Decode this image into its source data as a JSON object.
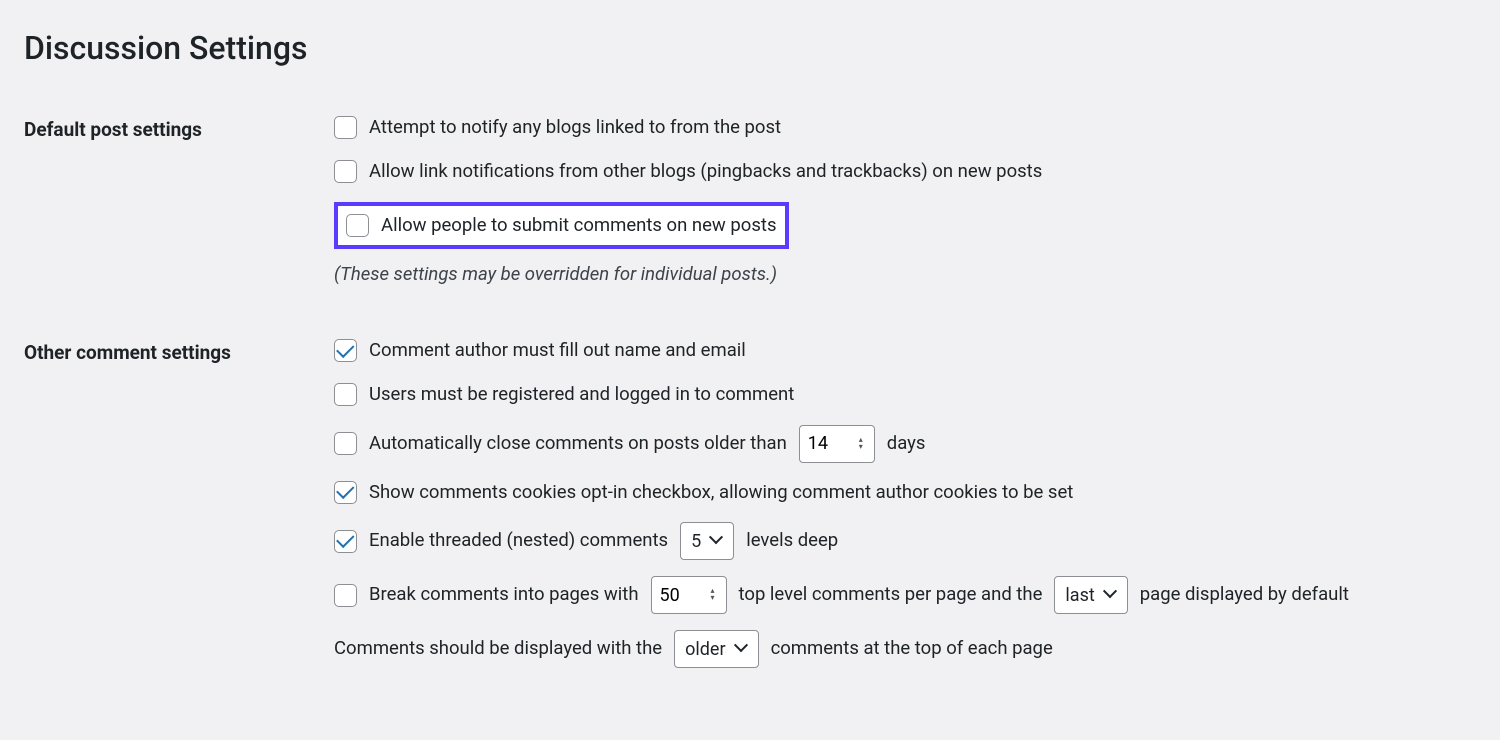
{
  "page_title": "Discussion Settings",
  "sections": {
    "default_post": {
      "heading": "Default post settings",
      "options": {
        "notify_blogs": {
          "label": "Attempt to notify any blogs linked to from the post",
          "checked": false
        },
        "allow_pingbacks": {
          "label": "Allow link notifications from other blogs (pingbacks and trackbacks) on new posts",
          "checked": false
        },
        "allow_comments": {
          "label": "Allow people to submit comments on new posts",
          "checked": false
        }
      },
      "note": "(These settings may be overridden for individual posts.)"
    },
    "other_comment": {
      "heading": "Other comment settings",
      "options": {
        "require_name_email": {
          "label": "Comment author must fill out name and email",
          "checked": true
        },
        "require_registered": {
          "label": "Users must be registered and logged in to comment",
          "checked": false
        },
        "auto_close": {
          "label_pre": "Automatically close comments on posts older than",
          "value": "14",
          "label_post": "days",
          "checked": false
        },
        "cookies_optin": {
          "label": "Show comments cookies opt-in checkbox, allowing comment author cookies to be set",
          "checked": true
        },
        "threaded": {
          "label_pre": "Enable threaded (nested) comments",
          "value": "5",
          "label_post": "levels deep",
          "checked": true
        },
        "paginate": {
          "label_pre": "Break comments into pages with",
          "per_page": "50",
          "label_mid": "top level comments per page and the",
          "default_page": "last",
          "label_post": "page displayed by default",
          "checked": false
        },
        "order": {
          "label_pre": "Comments should be displayed with the",
          "value": "older",
          "label_post": "comments at the top of each page"
        }
      }
    }
  }
}
